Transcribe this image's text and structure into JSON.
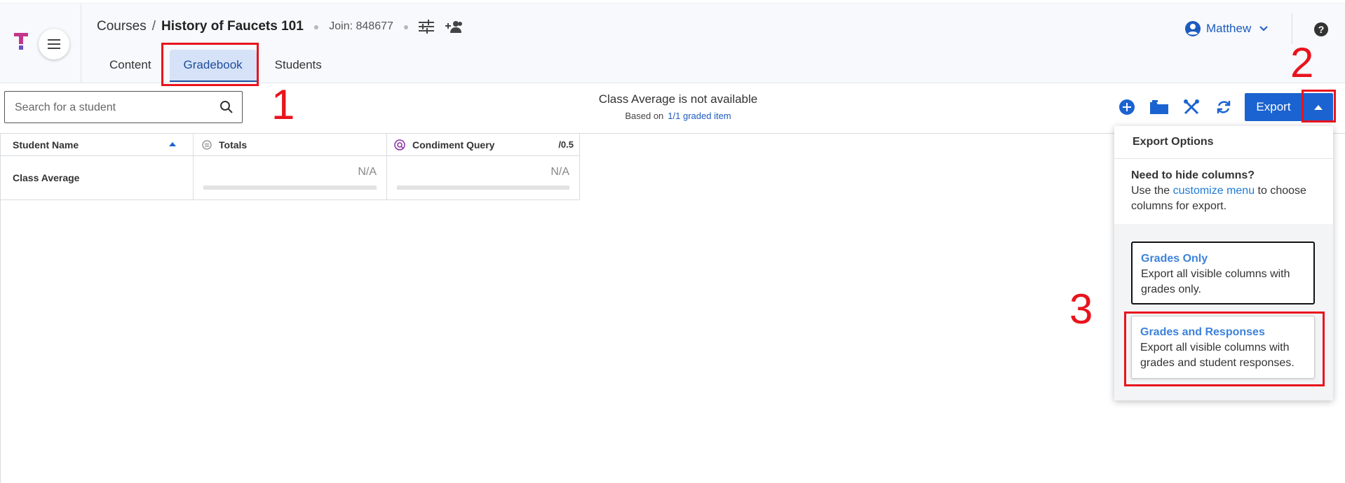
{
  "breadcrumb": {
    "courses": "Courses",
    "separator": "/",
    "course": "History of Faucets 101",
    "join": "Join: 848677"
  },
  "tabs": [
    {
      "label": "Content"
    },
    {
      "label": "Gradebook"
    },
    {
      "label": "Students"
    }
  ],
  "user": {
    "name": "Matthew"
  },
  "help": {
    "label": "?"
  },
  "search": {
    "placeholder": "Search for a student"
  },
  "class_average": {
    "title": "Class Average is not available",
    "based_on": "Based on",
    "link": "1/1 graded item"
  },
  "toolbar": {
    "export_label": "Export"
  },
  "columns": [
    {
      "label": "Student Name"
    },
    {
      "label": "Totals"
    },
    {
      "label": "Condiment Query",
      "points": "/0.5"
    }
  ],
  "rows": [
    {
      "name": "Class Average",
      "totals": "N/A",
      "condiment": "N/A"
    }
  ],
  "export_options": {
    "title": "Export Options",
    "hint_title": "Need to hide columns?",
    "hint_pre": "Use the ",
    "hint_link": "customize menu",
    "hint_post": " to choose columns for export.",
    "options": [
      {
        "title": "Grades Only",
        "desc": "Export all visible columns with grades only."
      },
      {
        "title": "Grades and Responses",
        "desc": "Export all visible columns with grades and student responses."
      }
    ]
  },
  "annotations": [
    "1",
    "2",
    "3"
  ],
  "colors": {
    "accent": "#1b63d0",
    "annotation": "#e8141d",
    "active_tab_bg": "#d6e2f7"
  }
}
